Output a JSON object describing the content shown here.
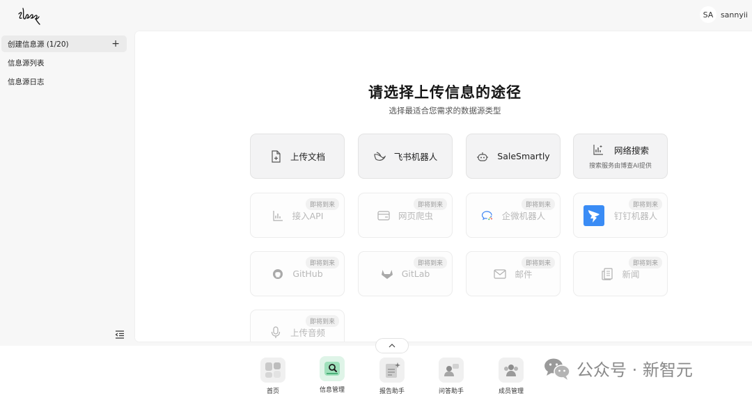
{
  "user": {
    "initials": "SA",
    "name": "sannyii"
  },
  "sidebar": {
    "items": [
      {
        "label": "创建信息源 (1/20)",
        "active": true
      },
      {
        "label": "信息源列表",
        "active": false
      },
      {
        "label": "信息源日志",
        "active": false
      }
    ]
  },
  "main": {
    "title": "请选择上传信息的途径",
    "subtitle": "选择最适合您需求的数据源类型",
    "coming_soon": "即将到来",
    "cards": [
      {
        "label": "上传文档",
        "icon": "file-plus-icon"
      },
      {
        "label": "飞书机器人",
        "icon": "feishu-icon"
      },
      {
        "label": "SaleSmartly",
        "icon": "bot-icon"
      },
      {
        "label": "网络搜索",
        "icon": "chart-search-icon",
        "desc": "搜索服务由博查AI提供"
      },
      {
        "label": "接入API",
        "icon": "api-icon"
      },
      {
        "label": "网页爬虫",
        "icon": "browser-icon"
      },
      {
        "label": "企微机器人",
        "icon": "wecom-icon"
      },
      {
        "label": "钉钉机器人",
        "icon": "dingtalk-icon"
      },
      {
        "label": "GitHub",
        "icon": "github-icon"
      },
      {
        "label": "GitLab",
        "icon": "gitlab-icon"
      },
      {
        "label": "邮件",
        "icon": "mail-icon"
      },
      {
        "label": "新闻",
        "icon": "news-icon"
      },
      {
        "label": "上传音频",
        "icon": "microphone-icon"
      }
    ]
  },
  "dock": {
    "items": [
      {
        "label": "首页",
        "icon": "home-grid-icon"
      },
      {
        "label": "信息管理",
        "icon": "info-search-icon",
        "active": true
      },
      {
        "label": "报告助手",
        "icon": "report-icon"
      },
      {
        "label": "问答助手",
        "icon": "qa-icon"
      },
      {
        "label": "成员管理",
        "icon": "members-icon"
      }
    ]
  },
  "watermark": {
    "text": "公众号 · 新智元"
  },
  "colors": {
    "accent_green": "#2f9e63",
    "dingtalk_blue": "#3a8cf5",
    "wecom_blue": "#2e7bf2",
    "gitlab_grey": "#6b6b6b"
  }
}
